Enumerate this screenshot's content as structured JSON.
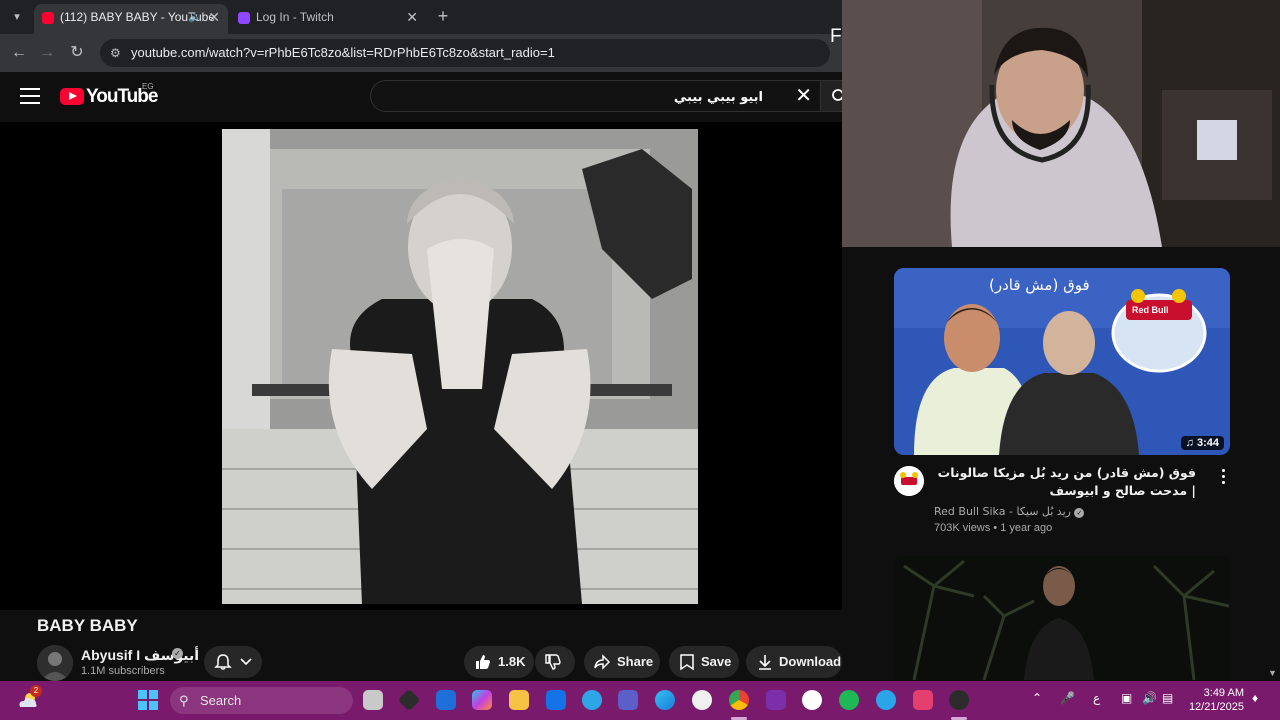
{
  "browser": {
    "tabs": [
      {
        "title": "(112) BABY BABY - YouTube",
        "active": true
      },
      {
        "title": "Log In - Twitch",
        "active": false
      }
    ],
    "url": "youtube.com/watch?v=rPhbE6Tc8zo&list=RDrPhbE6Tc8zo&start_radio=1",
    "cut_letter": "F"
  },
  "youtube": {
    "logo_text": "YouTube",
    "country_code": "EG",
    "search_value": "ابيو بيبي بيبي"
  },
  "video": {
    "title": "BABY BABY",
    "channel_name": "Abyusif I أبيوسف",
    "subscribers": "1.1M subscribers",
    "like_count": "1.8K",
    "share_label": "Share",
    "save_label": "Save",
    "download_label": "Download"
  },
  "recommendations": [
    {
      "title": "فوق (مش قادر) من ريد بُل مزيكا صالونات | مدحت صالح و ابيوسف",
      "channel": "Red Bull Sika - ريد بُل سيكا",
      "meta": "703K views • 1 year ago",
      "duration": "3:44",
      "thumb_text": "فوق (مش قادر)",
      "brand": "Red Bull"
    }
  ],
  "taskbar": {
    "search_placeholder": "Search",
    "time": "3:49 AM",
    "date": "12/21/2025",
    "notification_count": "2",
    "ime": "ع"
  }
}
